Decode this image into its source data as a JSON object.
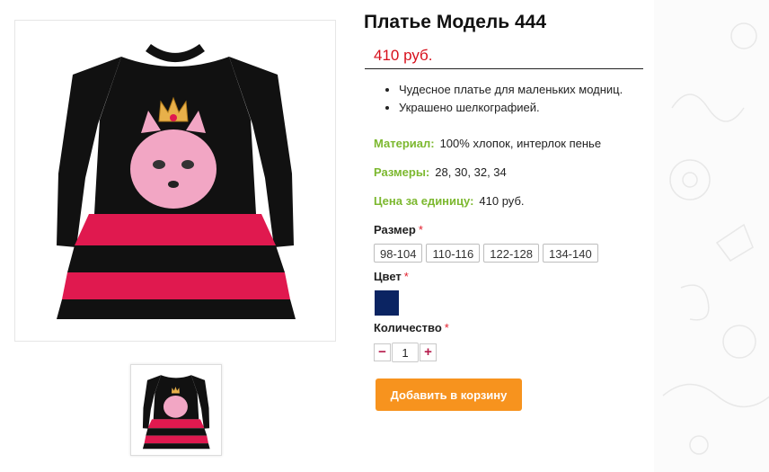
{
  "product": {
    "title": "Платье Модель 444",
    "price": "410 руб.",
    "features": [
      "Чудесное платье для маленьких модниц.",
      "Украшено шелкографией."
    ],
    "specs": {
      "material_label": "Материал:",
      "material_value": "100% хлопок, интерлок пенье",
      "sizes_label": "Размеры:",
      "sizes_value": "28, 30, 32, 34",
      "unit_price_label": "Цена за единицу:",
      "unit_price_value": "410 руб."
    }
  },
  "options": {
    "size_label": "Размер",
    "required_mark": "*",
    "sizes": [
      "98-104",
      "110-116",
      "122-128",
      "134-140"
    ],
    "color_label": "Цвет",
    "color_swatch": "#0b2462",
    "quantity_label": "Количество",
    "quantity_value": "1",
    "minus": "−",
    "plus": "+"
  },
  "cart": {
    "add_label": "Добавить в корзину"
  },
  "colors": {
    "accent_orange": "#f7931e",
    "price_red": "#d7101c",
    "spec_green": "#7cb82f"
  },
  "icons": {
    "main_image": "dress-image",
    "thumbnail": "dress-thumbnail"
  }
}
